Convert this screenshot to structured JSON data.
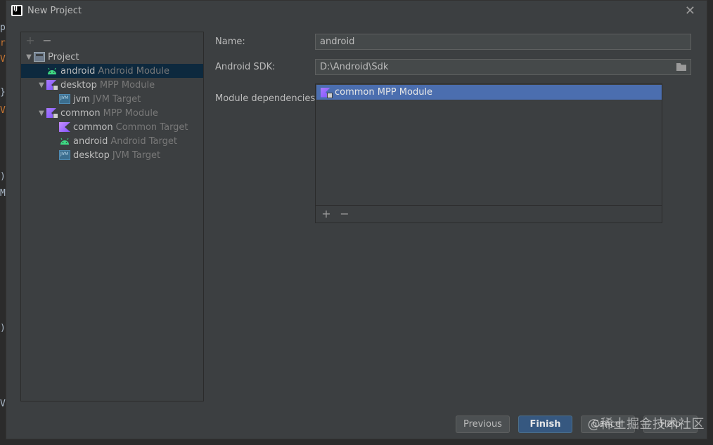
{
  "window": {
    "title": "New Project",
    "close_glyph": "✕",
    "app_icon_text": "IJ"
  },
  "background_glyphs": [
    "p",
    "r",
    "V",
    "}",
    "V",
    ")",
    "M",
    ")",
    "V"
  ],
  "tree_toolbar": {
    "add_glyph": "+",
    "remove_glyph": "−"
  },
  "tree": [
    {
      "label": "Project",
      "secondary": "",
      "icon": "project-icon",
      "expanded": true,
      "level": 0,
      "selected": false
    },
    {
      "label": "android",
      "secondary": "Android Module",
      "icon": "android-icon",
      "expanded": null,
      "level": 1,
      "selected": true
    },
    {
      "label": "desktop",
      "secondary": "MPP Module",
      "icon": "mpp-module-icon",
      "expanded": true,
      "level": 1,
      "selected": false
    },
    {
      "label": "jvm",
      "secondary": "JVM Target",
      "icon": "jvm-icon",
      "expanded": null,
      "level": 2,
      "selected": false
    },
    {
      "label": "common",
      "secondary": "MPP Module",
      "icon": "mpp-module-icon",
      "expanded": true,
      "level": 1,
      "selected": false
    },
    {
      "label": "common",
      "secondary": "Common Target",
      "icon": "kotlin-icon",
      "expanded": null,
      "level": 2,
      "selected": false
    },
    {
      "label": "android",
      "secondary": "Android Target",
      "icon": "android-icon",
      "expanded": null,
      "level": 2,
      "selected": false
    },
    {
      "label": "desktop",
      "secondary": "JVM Target",
      "icon": "jvm-icon",
      "expanded": null,
      "level": 2,
      "selected": false
    }
  ],
  "form": {
    "name_label": "Name:",
    "name_value": "android",
    "sdk_label": "Android SDK:",
    "sdk_value": "D:\\Android\\Sdk",
    "deps_label": "Module dependencies:",
    "deps": [
      {
        "label": "common MPP Module",
        "icon": "mpp-module-icon"
      }
    ],
    "deps_add_glyph": "+",
    "deps_remove_glyph": "−"
  },
  "buttons": {
    "previous": "Previous",
    "finish": "Finish",
    "cancel": "Cancel",
    "help": "Help"
  },
  "watermark": "@稀土掘金技术社区",
  "colors": {
    "dialog_bg": "#3c3f41",
    "selection": "#0d293e",
    "list_selection": "#4b6eaf",
    "android_green": "#3ddc84",
    "kotlin_purple": "#7f52ff",
    "primary_button": "#365880"
  }
}
